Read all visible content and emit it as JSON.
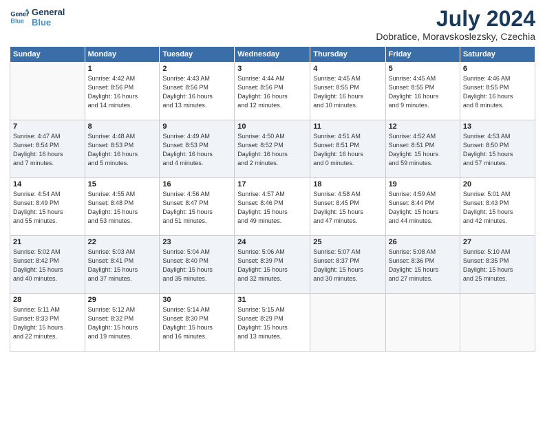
{
  "logo": {
    "line1": "General",
    "line2": "Blue"
  },
  "title": "July 2024",
  "subtitle": "Dobratice, Moravskoslezsky, Czechia",
  "days_of_week": [
    "Sunday",
    "Monday",
    "Tuesday",
    "Wednesday",
    "Thursday",
    "Friday",
    "Saturday"
  ],
  "weeks": [
    [
      {
        "day": "",
        "info": ""
      },
      {
        "day": "1",
        "info": "Sunrise: 4:42 AM\nSunset: 8:56 PM\nDaylight: 16 hours\nand 14 minutes."
      },
      {
        "day": "2",
        "info": "Sunrise: 4:43 AM\nSunset: 8:56 PM\nDaylight: 16 hours\nand 13 minutes."
      },
      {
        "day": "3",
        "info": "Sunrise: 4:44 AM\nSunset: 8:56 PM\nDaylight: 16 hours\nand 12 minutes."
      },
      {
        "day": "4",
        "info": "Sunrise: 4:45 AM\nSunset: 8:55 PM\nDaylight: 16 hours\nand 10 minutes."
      },
      {
        "day": "5",
        "info": "Sunrise: 4:45 AM\nSunset: 8:55 PM\nDaylight: 16 hours\nand 9 minutes."
      },
      {
        "day": "6",
        "info": "Sunrise: 4:46 AM\nSunset: 8:55 PM\nDaylight: 16 hours\nand 8 minutes."
      }
    ],
    [
      {
        "day": "7",
        "info": "Sunrise: 4:47 AM\nSunset: 8:54 PM\nDaylight: 16 hours\nand 7 minutes."
      },
      {
        "day": "8",
        "info": "Sunrise: 4:48 AM\nSunset: 8:53 PM\nDaylight: 16 hours\nand 5 minutes."
      },
      {
        "day": "9",
        "info": "Sunrise: 4:49 AM\nSunset: 8:53 PM\nDaylight: 16 hours\nand 4 minutes."
      },
      {
        "day": "10",
        "info": "Sunrise: 4:50 AM\nSunset: 8:52 PM\nDaylight: 16 hours\nand 2 minutes."
      },
      {
        "day": "11",
        "info": "Sunrise: 4:51 AM\nSunset: 8:51 PM\nDaylight: 16 hours\nand 0 minutes."
      },
      {
        "day": "12",
        "info": "Sunrise: 4:52 AM\nSunset: 8:51 PM\nDaylight: 15 hours\nand 59 minutes."
      },
      {
        "day": "13",
        "info": "Sunrise: 4:53 AM\nSunset: 8:50 PM\nDaylight: 15 hours\nand 57 minutes."
      }
    ],
    [
      {
        "day": "14",
        "info": "Sunrise: 4:54 AM\nSunset: 8:49 PM\nDaylight: 15 hours\nand 55 minutes."
      },
      {
        "day": "15",
        "info": "Sunrise: 4:55 AM\nSunset: 8:48 PM\nDaylight: 15 hours\nand 53 minutes."
      },
      {
        "day": "16",
        "info": "Sunrise: 4:56 AM\nSunset: 8:47 PM\nDaylight: 15 hours\nand 51 minutes."
      },
      {
        "day": "17",
        "info": "Sunrise: 4:57 AM\nSunset: 8:46 PM\nDaylight: 15 hours\nand 49 minutes."
      },
      {
        "day": "18",
        "info": "Sunrise: 4:58 AM\nSunset: 8:45 PM\nDaylight: 15 hours\nand 47 minutes."
      },
      {
        "day": "19",
        "info": "Sunrise: 4:59 AM\nSunset: 8:44 PM\nDaylight: 15 hours\nand 44 minutes."
      },
      {
        "day": "20",
        "info": "Sunrise: 5:01 AM\nSunset: 8:43 PM\nDaylight: 15 hours\nand 42 minutes."
      }
    ],
    [
      {
        "day": "21",
        "info": "Sunrise: 5:02 AM\nSunset: 8:42 PM\nDaylight: 15 hours\nand 40 minutes."
      },
      {
        "day": "22",
        "info": "Sunrise: 5:03 AM\nSunset: 8:41 PM\nDaylight: 15 hours\nand 37 minutes."
      },
      {
        "day": "23",
        "info": "Sunrise: 5:04 AM\nSunset: 8:40 PM\nDaylight: 15 hours\nand 35 minutes."
      },
      {
        "day": "24",
        "info": "Sunrise: 5:06 AM\nSunset: 8:39 PM\nDaylight: 15 hours\nand 32 minutes."
      },
      {
        "day": "25",
        "info": "Sunrise: 5:07 AM\nSunset: 8:37 PM\nDaylight: 15 hours\nand 30 minutes."
      },
      {
        "day": "26",
        "info": "Sunrise: 5:08 AM\nSunset: 8:36 PM\nDaylight: 15 hours\nand 27 minutes."
      },
      {
        "day": "27",
        "info": "Sunrise: 5:10 AM\nSunset: 8:35 PM\nDaylight: 15 hours\nand 25 minutes."
      }
    ],
    [
      {
        "day": "28",
        "info": "Sunrise: 5:11 AM\nSunset: 8:33 PM\nDaylight: 15 hours\nand 22 minutes."
      },
      {
        "day": "29",
        "info": "Sunrise: 5:12 AM\nSunset: 8:32 PM\nDaylight: 15 hours\nand 19 minutes."
      },
      {
        "day": "30",
        "info": "Sunrise: 5:14 AM\nSunset: 8:30 PM\nDaylight: 15 hours\nand 16 minutes."
      },
      {
        "day": "31",
        "info": "Sunrise: 5:15 AM\nSunset: 8:29 PM\nDaylight: 15 hours\nand 13 minutes."
      },
      {
        "day": "",
        "info": ""
      },
      {
        "day": "",
        "info": ""
      },
      {
        "day": "",
        "info": ""
      }
    ]
  ]
}
